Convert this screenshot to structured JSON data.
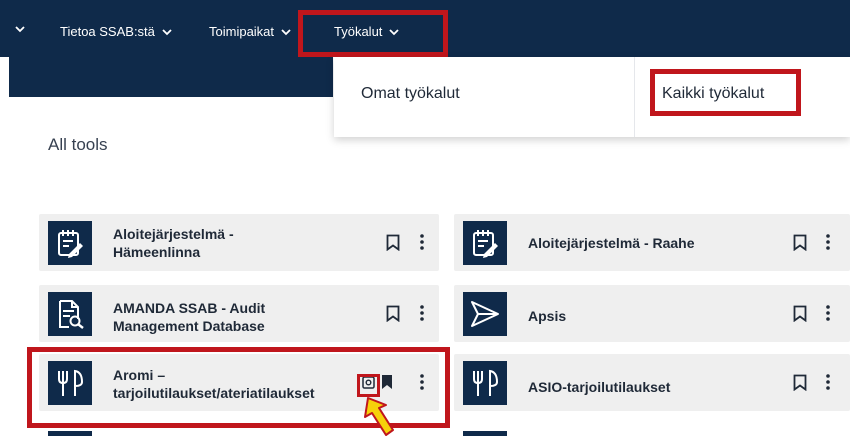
{
  "nav": {
    "items": [
      {
        "label": ""
      },
      {
        "label": "Tietoa SSAB:stä"
      },
      {
        "label": "Toimipaikat"
      },
      {
        "label": "Työkalut"
      }
    ]
  },
  "dropdown": {
    "own_tools": "Omat työkalut",
    "all_tools": "Kaikki työkalut"
  },
  "page": {
    "heading": "All tools"
  },
  "tools": [
    {
      "name": "Aloitejärjestelmä -",
      "name2": "Hämeenlinna",
      "icon": "notepad-pen-icon"
    },
    {
      "name": "Aloitejärjestelmä - Raahe",
      "icon": "notepad-pen-icon"
    },
    {
      "name": "AMANDA SSAB - Audit",
      "name2": "Management Database",
      "icon": "document-search-icon"
    },
    {
      "name": "Apsis",
      "icon": "send-icon"
    },
    {
      "name": "Aromi –",
      "name2": "tarjoilutilaukset/ateriatilaukset",
      "icon": "fork-knife-icon"
    },
    {
      "name": "ASIO-tarjoilutilaukset",
      "icon": "fork-knife-icon"
    }
  ],
  "colors": {
    "nav_bg": "#0f2a4a",
    "highlight": "#c0161c",
    "card_bg": "#efefef",
    "arrow": "#f6d20a"
  }
}
